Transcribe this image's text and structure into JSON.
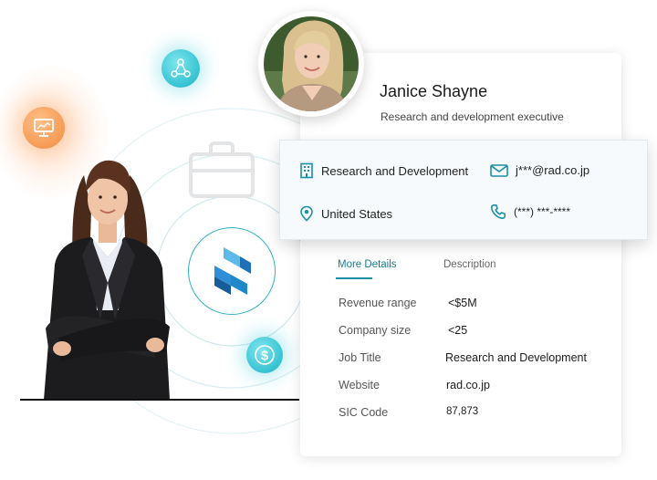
{
  "profile": {
    "name": "Janice Shayne",
    "title": "Research and development executive"
  },
  "contact": {
    "department": "Research and Development",
    "email": "j***@rad.co.jp",
    "location": "United States",
    "phone": "(***) ***-****"
  },
  "tabs": [
    {
      "label": "More Details",
      "active": true
    },
    {
      "label": "Description",
      "active": false
    }
  ],
  "details": [
    {
      "label": "Revenue range",
      "value": "<$5M"
    },
    {
      "label": "Company size",
      "value": "<25"
    },
    {
      "label": "Job Title",
      "value": "Research and Development"
    },
    {
      "label": "Website",
      "value": "rad.co.jp"
    },
    {
      "label": "SIC Code",
      "value": "87,873"
    }
  ],
  "colors": {
    "accent": "#1a8fa3",
    "orb_teal": "#17b3c6",
    "orb_orange": "#f28a3c",
    "logo_blue": "#1e88c9"
  },
  "icons": {
    "orbs": [
      "monitor-icon",
      "network-icon",
      "dollar-icon"
    ],
    "background": "briefcase-icon",
    "contact": [
      "building-icon",
      "email-icon",
      "location-pin-icon",
      "phone-icon"
    ]
  }
}
